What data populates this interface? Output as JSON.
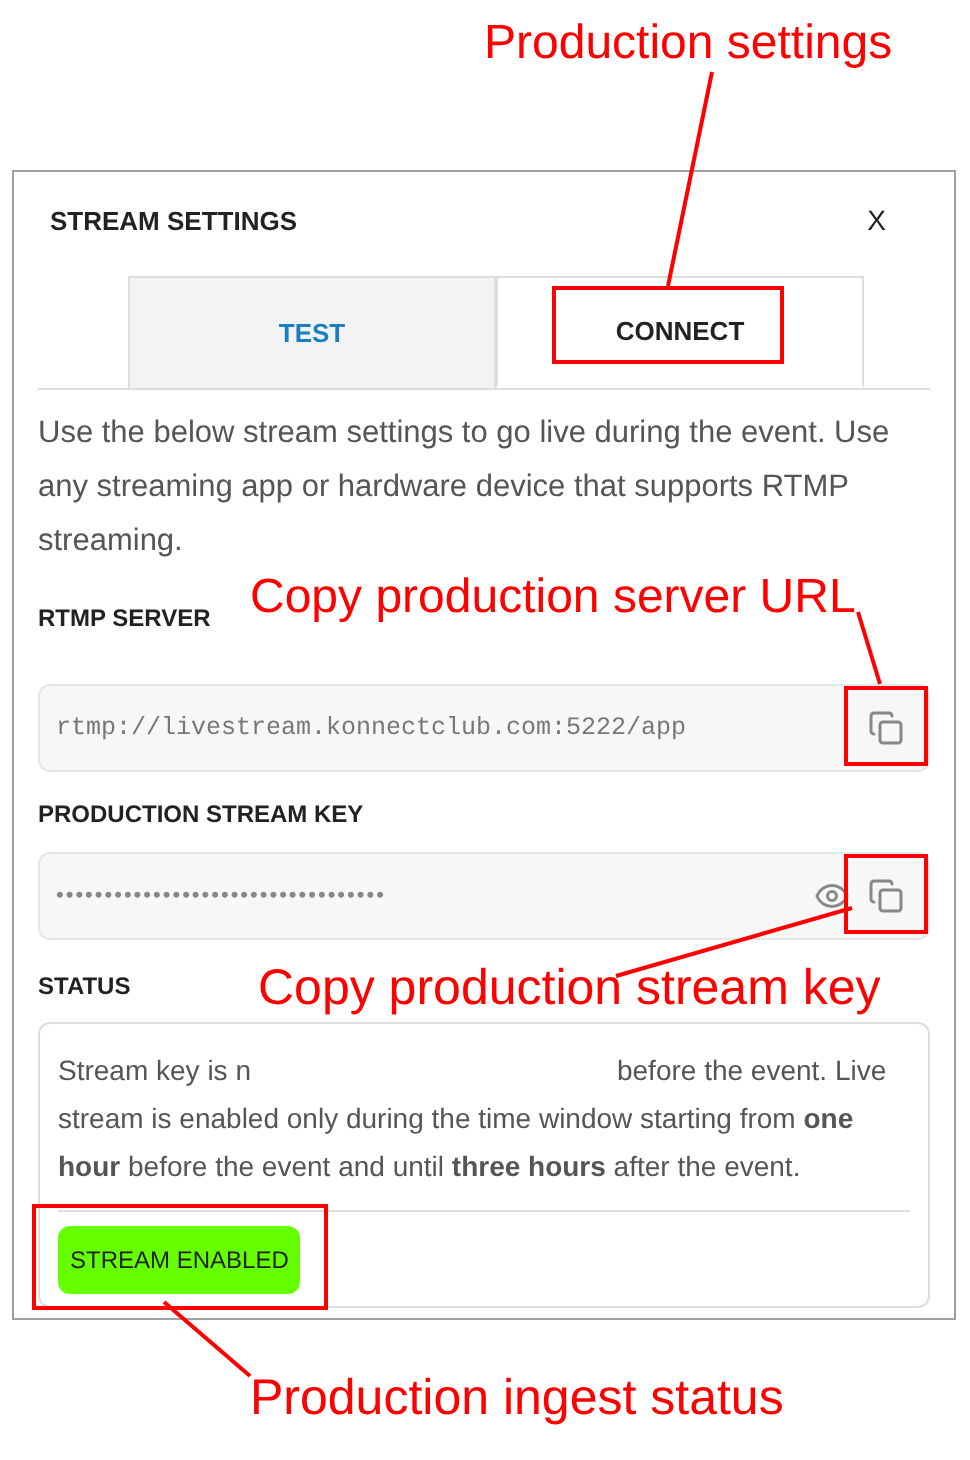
{
  "annotations": [
    {
      "text": "Production settings"
    },
    {
      "text": "Copy production server URL"
    },
    {
      "text": "Copy production stream key"
    },
    {
      "text": "Production ingest status"
    }
  ],
  "dialog": {
    "title": "STREAM SETTINGS",
    "close": "X",
    "tabs": [
      {
        "label": "TEST",
        "selected": false
      },
      {
        "label": "CONNECT",
        "selected": true
      }
    ],
    "description": "Use the below stream settings to go live during the event. Use any streaming app or hardware device that supports RTMP streaming.",
    "fields": [
      {
        "label": "RTMP SERVER",
        "value": "rtmp://livestream.konnectclub.com:5222/app",
        "kind": "plain"
      },
      {
        "label": "PRODUCTION STREAM KEY",
        "value": "••••••••••••••••••••••••••••••••••",
        "kind": "secret"
      }
    ],
    "status": {
      "label": "STATUS",
      "text_start": "Stream key is n",
      "text_mid": "before the event. Live",
      "text_rest": "stream is enabled only during the time window starting from **one hour** before the event and until **three hours** after the event.",
      "badge": {
        "text": "STREAM ENABLED",
        "enabled": true
      }
    }
  }
}
